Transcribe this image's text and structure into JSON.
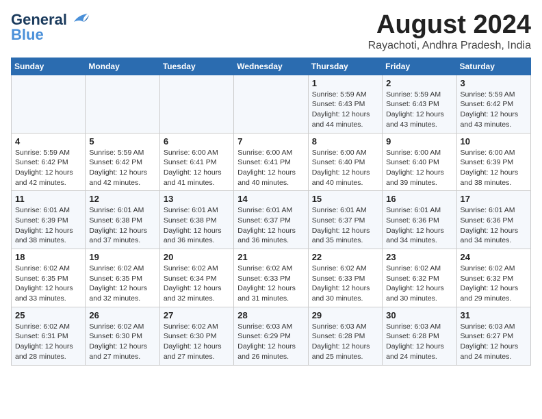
{
  "logo": {
    "line1": "General",
    "line2": "Blue"
  },
  "title": "August 2024",
  "subtitle": "Rayachoti, Andhra Pradesh, India",
  "days_of_week": [
    "Sunday",
    "Monday",
    "Tuesday",
    "Wednesday",
    "Thursday",
    "Friday",
    "Saturday"
  ],
  "weeks": [
    [
      {
        "day": "",
        "info": ""
      },
      {
        "day": "",
        "info": ""
      },
      {
        "day": "",
        "info": ""
      },
      {
        "day": "",
        "info": ""
      },
      {
        "day": "1",
        "info": "Sunrise: 5:59 AM\nSunset: 6:43 PM\nDaylight: 12 hours\nand 44 minutes."
      },
      {
        "day": "2",
        "info": "Sunrise: 5:59 AM\nSunset: 6:43 PM\nDaylight: 12 hours\nand 43 minutes."
      },
      {
        "day": "3",
        "info": "Sunrise: 5:59 AM\nSunset: 6:42 PM\nDaylight: 12 hours\nand 43 minutes."
      }
    ],
    [
      {
        "day": "4",
        "info": "Sunrise: 5:59 AM\nSunset: 6:42 PM\nDaylight: 12 hours\nand 42 minutes."
      },
      {
        "day": "5",
        "info": "Sunrise: 5:59 AM\nSunset: 6:42 PM\nDaylight: 12 hours\nand 42 minutes."
      },
      {
        "day": "6",
        "info": "Sunrise: 6:00 AM\nSunset: 6:41 PM\nDaylight: 12 hours\nand 41 minutes."
      },
      {
        "day": "7",
        "info": "Sunrise: 6:00 AM\nSunset: 6:41 PM\nDaylight: 12 hours\nand 40 minutes."
      },
      {
        "day": "8",
        "info": "Sunrise: 6:00 AM\nSunset: 6:40 PM\nDaylight: 12 hours\nand 40 minutes."
      },
      {
        "day": "9",
        "info": "Sunrise: 6:00 AM\nSunset: 6:40 PM\nDaylight: 12 hours\nand 39 minutes."
      },
      {
        "day": "10",
        "info": "Sunrise: 6:00 AM\nSunset: 6:39 PM\nDaylight: 12 hours\nand 38 minutes."
      }
    ],
    [
      {
        "day": "11",
        "info": "Sunrise: 6:01 AM\nSunset: 6:39 PM\nDaylight: 12 hours\nand 38 minutes."
      },
      {
        "day": "12",
        "info": "Sunrise: 6:01 AM\nSunset: 6:38 PM\nDaylight: 12 hours\nand 37 minutes."
      },
      {
        "day": "13",
        "info": "Sunrise: 6:01 AM\nSunset: 6:38 PM\nDaylight: 12 hours\nand 36 minutes."
      },
      {
        "day": "14",
        "info": "Sunrise: 6:01 AM\nSunset: 6:37 PM\nDaylight: 12 hours\nand 36 minutes."
      },
      {
        "day": "15",
        "info": "Sunrise: 6:01 AM\nSunset: 6:37 PM\nDaylight: 12 hours\nand 35 minutes."
      },
      {
        "day": "16",
        "info": "Sunrise: 6:01 AM\nSunset: 6:36 PM\nDaylight: 12 hours\nand 34 minutes."
      },
      {
        "day": "17",
        "info": "Sunrise: 6:01 AM\nSunset: 6:36 PM\nDaylight: 12 hours\nand 34 minutes."
      }
    ],
    [
      {
        "day": "18",
        "info": "Sunrise: 6:02 AM\nSunset: 6:35 PM\nDaylight: 12 hours\nand 33 minutes."
      },
      {
        "day": "19",
        "info": "Sunrise: 6:02 AM\nSunset: 6:35 PM\nDaylight: 12 hours\nand 32 minutes."
      },
      {
        "day": "20",
        "info": "Sunrise: 6:02 AM\nSunset: 6:34 PM\nDaylight: 12 hours\nand 32 minutes."
      },
      {
        "day": "21",
        "info": "Sunrise: 6:02 AM\nSunset: 6:33 PM\nDaylight: 12 hours\nand 31 minutes."
      },
      {
        "day": "22",
        "info": "Sunrise: 6:02 AM\nSunset: 6:33 PM\nDaylight: 12 hours\nand 30 minutes."
      },
      {
        "day": "23",
        "info": "Sunrise: 6:02 AM\nSunset: 6:32 PM\nDaylight: 12 hours\nand 30 minutes."
      },
      {
        "day": "24",
        "info": "Sunrise: 6:02 AM\nSunset: 6:32 PM\nDaylight: 12 hours\nand 29 minutes."
      }
    ],
    [
      {
        "day": "25",
        "info": "Sunrise: 6:02 AM\nSunset: 6:31 PM\nDaylight: 12 hours\nand 28 minutes."
      },
      {
        "day": "26",
        "info": "Sunrise: 6:02 AM\nSunset: 6:30 PM\nDaylight: 12 hours\nand 27 minutes."
      },
      {
        "day": "27",
        "info": "Sunrise: 6:02 AM\nSunset: 6:30 PM\nDaylight: 12 hours\nand 27 minutes."
      },
      {
        "day": "28",
        "info": "Sunrise: 6:03 AM\nSunset: 6:29 PM\nDaylight: 12 hours\nand 26 minutes."
      },
      {
        "day": "29",
        "info": "Sunrise: 6:03 AM\nSunset: 6:28 PM\nDaylight: 12 hours\nand 25 minutes."
      },
      {
        "day": "30",
        "info": "Sunrise: 6:03 AM\nSunset: 6:28 PM\nDaylight: 12 hours\nand 24 minutes."
      },
      {
        "day": "31",
        "info": "Sunrise: 6:03 AM\nSunset: 6:27 PM\nDaylight: 12 hours\nand 24 minutes."
      }
    ]
  ]
}
